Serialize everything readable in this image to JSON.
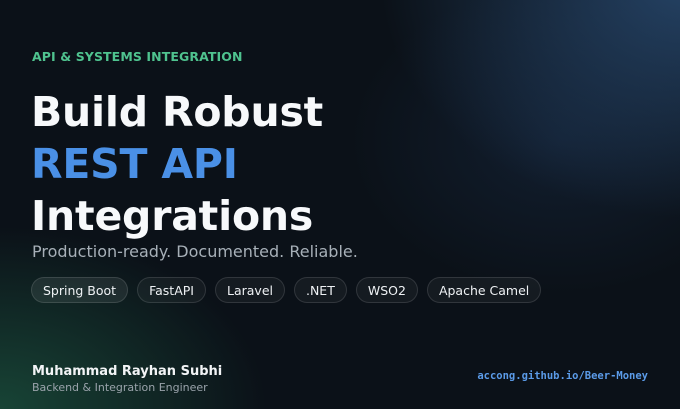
{
  "eyebrow": "API & SYSTEMS INTEGRATION",
  "headline": {
    "line1": "Build Robust",
    "line2": "REST API",
    "line3": "Integrations"
  },
  "subtitle": "Production-ready. Documented. Reliable.",
  "tags": [
    "Spring Boot",
    "FastAPI",
    "Laravel",
    ".NET",
    "WSO2",
    "Apache Camel"
  ],
  "author": {
    "name": "Muhammad Rayhan Subhi",
    "role": "Backend & Integration Engineer"
  },
  "url": "accong.github.io/Beer-Money",
  "colors": {
    "eyebrow": "#4fc38f",
    "accent": "#4a90e6",
    "url": "#5b9be8",
    "background": "#0b1118"
  }
}
